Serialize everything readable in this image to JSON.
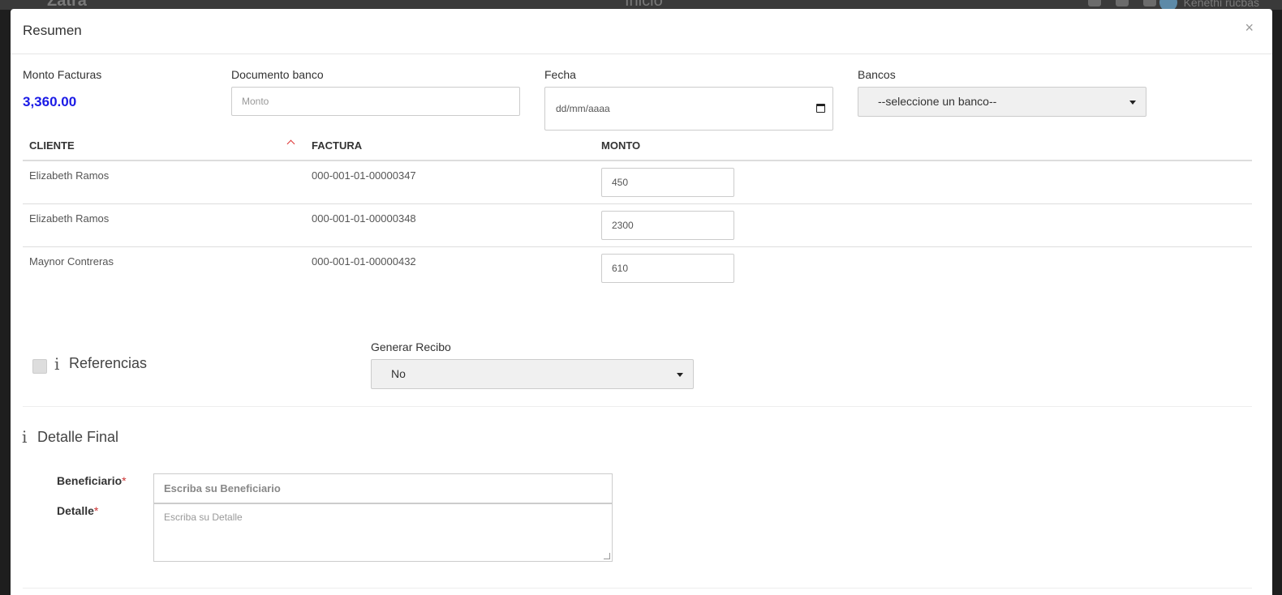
{
  "background": {
    "logo": "Zatra",
    "title": "Inicio",
    "user_name": "Kenethi rucbas"
  },
  "modal": {
    "title": "Resumen",
    "close_glyph": "×"
  },
  "summary": {
    "monto_facturas_label": "Monto Facturas",
    "monto_facturas_value": "3,360.00",
    "documento_banco_label": "Documento banco",
    "documento_banco_placeholder": "Monto",
    "fecha_label": "Fecha",
    "fecha_placeholder": "dd/mm/aaaa",
    "bancos_label": "Bancos",
    "bancos_selected": "--seleccione un banco--"
  },
  "table": {
    "headers": [
      "CLIENTE",
      "FACTURA",
      "MONTO"
    ],
    "rows": [
      {
        "cliente": "Elizabeth Ramos",
        "factura": "000-001-01-00000347",
        "monto": "450"
      },
      {
        "cliente": "Elizabeth Ramos",
        "factura": "000-001-01-00000348",
        "monto": "2300"
      },
      {
        "cliente": "Maynor Contreras",
        "factura": "000-001-01-00000432",
        "monto": "610"
      }
    ]
  },
  "referencias": {
    "label": "Referencias",
    "checked": false
  },
  "generar_recibo": {
    "label": "Generar Recibo",
    "selected": "No"
  },
  "detalle_final": {
    "title": "Detalle Final",
    "beneficiario_label": "Beneficiario",
    "beneficiario_placeholder": "Escriba su Beneficiario",
    "detalle_label": "Detalle",
    "detalle_placeholder": "Escriba su Detalle",
    "required_mark": "*"
  },
  "colors": {
    "accent_amount": "#1a1ae6",
    "required": "#cc3333",
    "sort_indicator": "#dd3333"
  },
  "icons": {
    "info": "info-icon",
    "calendar": "calendar-icon",
    "caret": "caret-down-icon",
    "sort": "sort-asc-icon"
  }
}
